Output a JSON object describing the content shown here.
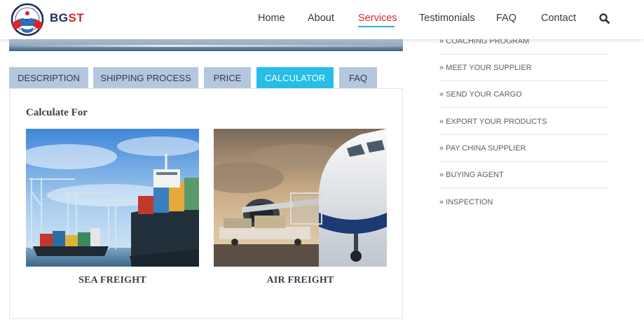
{
  "header": {
    "brand": {
      "part1": "BG",
      "part2": "ST"
    },
    "nav": [
      {
        "label": "Home"
      },
      {
        "label": "About"
      },
      {
        "label": "Services",
        "active": true
      },
      {
        "label": "Testimonials"
      },
      {
        "label": "FAQ"
      },
      {
        "label": "Contact"
      }
    ],
    "search_icon": "search-icon"
  },
  "tabs": [
    {
      "label": "DESCRIPTION"
    },
    {
      "label": "SHIPPING PROCESS"
    },
    {
      "label": "PRICE"
    },
    {
      "label": "CALCULATOR",
      "active": true
    },
    {
      "label": "FAQ"
    }
  ],
  "calculator": {
    "title": "Calculate For",
    "options": [
      {
        "label": "SEA FREIGHT",
        "image": "cargo ship at container port"
      },
      {
        "label": "AIR FREIGHT",
        "image": "cargo plane being loaded"
      }
    ]
  },
  "sidebar": {
    "items": [
      {
        "label": "» COACHING PROGRAM"
      },
      {
        "label": "» MEET YOUR SUPPLIER"
      },
      {
        "label": "» SEND YOUR CARGO"
      },
      {
        "label": "» EXPORT YOUR PRODUCTS"
      },
      {
        "label": "» PAY CHINA SUPPLIER"
      },
      {
        "label": "» BUYING AGENT"
      },
      {
        "label": "» INSPECTION"
      }
    ]
  },
  "colors": {
    "accent": "#26bde8",
    "brand_red": "#d7262d",
    "brand_navy": "#1e2b5a",
    "tab_inactive": "#b5c7de"
  }
}
